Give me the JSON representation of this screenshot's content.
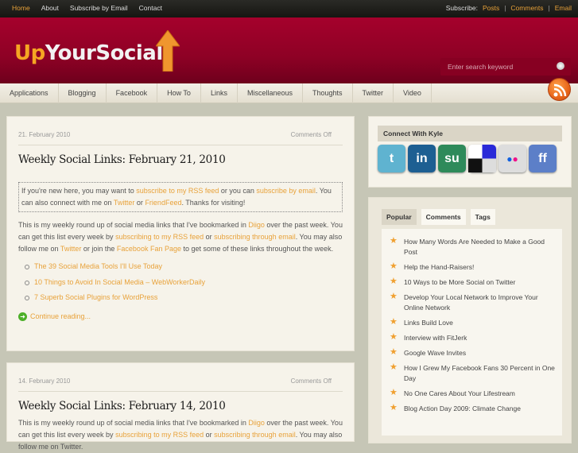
{
  "topbar": {
    "links": [
      "Home",
      "About",
      "Subscribe by Email",
      "Contact"
    ],
    "subscribe_label": "Subscribe:",
    "subscribe_links": [
      "Posts",
      "Comments",
      "Email"
    ],
    "sep": "|"
  },
  "header": {
    "logo_up": "Up",
    "logo_rest": "YourSocial",
    "search_placeholder": "Enter search keyword"
  },
  "nav": [
    "Applications",
    "Blogging",
    "Facebook",
    "How To",
    "Links",
    "Miscellaneous",
    "Thoughts",
    "Twitter",
    "Video"
  ],
  "posts": [
    {
      "date": "21. February 2010",
      "comments": "Comments Off",
      "title": "Weekly Social Links: February 21, 2010",
      "notice": [
        {
          "t": "If you're new here, you may want to "
        },
        {
          "t": "subscribe to my RSS feed",
          "l": 1
        },
        {
          "t": " or you can "
        },
        {
          "t": "subscribe by email",
          "l": 1
        },
        {
          "t": ". You can also connect with me on "
        },
        {
          "t": "Twitter",
          "l": 1
        },
        {
          "t": " or "
        },
        {
          "t": "FriendFeed",
          "l": 1
        },
        {
          "t": ". Thanks for visiting!"
        }
      ],
      "body": [
        {
          "t": "This is my weekly round up of social media links that I've bookmarked in "
        },
        {
          "t": "Diigo",
          "l": 1
        },
        {
          "t": " over the past week. You can get this list every week by "
        },
        {
          "t": "subscribing to my RSS feed",
          "l": 1
        },
        {
          "t": " or "
        },
        {
          "t": "subscribing through email",
          "l": 1
        },
        {
          "t": ". You may also follow me on "
        },
        {
          "t": "Twitter",
          "l": 1
        },
        {
          "t": " or join the "
        },
        {
          "t": "Facebook Fan Page",
          "l": 1
        },
        {
          "t": " to get some of these links throughout the week."
        }
      ],
      "links": [
        "The 39 Social Media Tools I'll Use Today",
        "10 Things to Avoid In Social Media – WebWorkerDaily",
        "7 Superb Social Plugins for WordPress"
      ],
      "continue": "Continue reading..."
    },
    {
      "date": "14. February 2010",
      "comments": "Comments Off",
      "title": "Weekly Social Links: February 14, 2010",
      "body": [
        {
          "t": "This is my weekly round up of social media links that I've bookmarked in "
        },
        {
          "t": "Diigo",
          "l": 1
        },
        {
          "t": " over the past week. You can get this list every week by "
        },
        {
          "t": "subscribing to my RSS feed",
          "l": 1
        },
        {
          "t": " or "
        },
        {
          "t": "subscribing through email",
          "l": 1
        },
        {
          "t": ". You may also follow me on Twitter."
        }
      ]
    }
  ],
  "sidebar": {
    "connect_title": "Connect With Kyle",
    "social_icons": [
      {
        "name": "twitter",
        "glyph": "t",
        "color": "#5fb3d0"
      },
      {
        "name": "linkedin",
        "glyph": "in",
        "color": "#1d5f92"
      },
      {
        "name": "stumbleupon",
        "glyph": "su",
        "color": "#2e8a5a"
      },
      {
        "name": "delicious",
        "glyph": "",
        "color": "#ffffff"
      },
      {
        "name": "flickr",
        "glyph": "",
        "color": "#dddddd"
      },
      {
        "name": "friendfeed",
        "glyph": "ff",
        "color": "#5c7fc8"
      }
    ],
    "tabs": [
      "Popular",
      "Comments",
      "Tags"
    ],
    "popular": [
      "How Many Words Are Needed to Make a Good Post",
      "Help the Hand-Raisers!",
      "10 Ways to be More Social on Twitter",
      "Develop Your Local Network to Improve Your Online Network",
      "Links Build Love",
      "Interview with FitJerk",
      "Google Wave Invites",
      "How I Grew My Facebook Fans 30 Percent in One Day",
      "No One Cares About Your Lifestream",
      "Blog Action Day 2009: Climate Change"
    ]
  },
  "colors": {
    "accent": "#e8a23a",
    "header": "#9a0129",
    "topbar": "#1e1e1a"
  }
}
